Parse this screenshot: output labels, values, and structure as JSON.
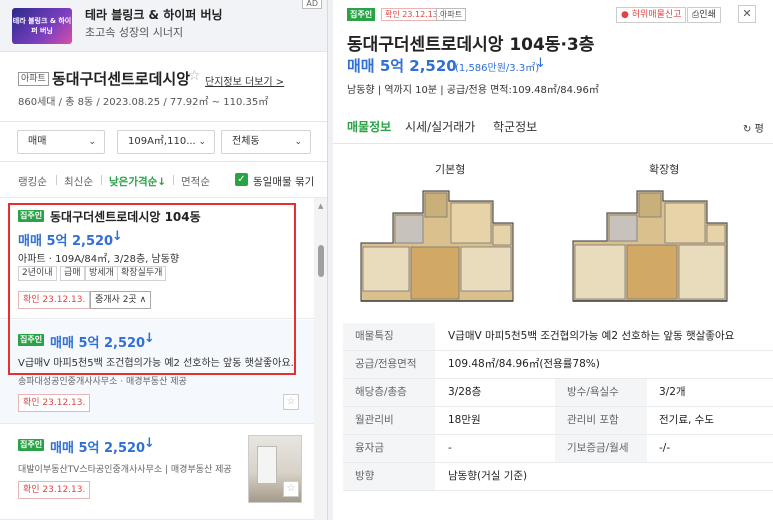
{
  "ad": {
    "thumb_text": "테라 블링크 & 하이퍼 버닝",
    "title": "테라 블링크 & 하이퍼 버닝",
    "subtitle": "초고속 성장의 시너지",
    "badge": "AD"
  },
  "complex": {
    "tag": "아파트",
    "name": "동대구더센트로데시앙",
    "star": "☆",
    "more_link": "단지정보 더보기 >",
    "info": "860세대 / 총 8동 / 2023.08.25 / 77.92㎡ ~ 110.35㎡"
  },
  "filters": {
    "trade_type": "매매",
    "area": "109A㎡,110...",
    "building": "전체동"
  },
  "sort": {
    "options": [
      "랭킹순",
      "최신순",
      "낮은가격순↓",
      "면적순"
    ],
    "active_index": 2,
    "same_listing_label": "동일매물 묶기",
    "same_listing_checked": true
  },
  "listings": [
    {
      "verify_tag": "집주인",
      "title": "동대구더센트로데시앙 104동",
      "price": "매매 5억 2,520",
      "arrow": "↓",
      "desc": "아파트 · 109A/84㎡, 3/28층, 남동향",
      "chips": [
        "2년이내",
        "급매",
        "방세개",
        "확장실두개"
      ],
      "confirm": "확인 23.12.13.",
      "agent_btn": "중개사 2곳 ∧"
    },
    {
      "verify_tag": "집주인",
      "price": "매매 5억 2,520",
      "arrow": "↓",
      "desc": "V급매V 마피5천5백 조건협의가능 예2 선호하는 앞동 햇살좋아요.",
      "source": "송파대성공인중개사사무소 · 매경부동산 제공",
      "confirm": "확인 23.12.13.",
      "fav": "☆"
    },
    {
      "verify_tag": "집주인",
      "price": "매매 5억 2,520",
      "arrow": "↓",
      "source": "대발이부동산TV스타공인중개사사무소 | 매경부동산 제공",
      "confirm": "확인 23.12.13.",
      "fav": "☆"
    }
  ],
  "detail": {
    "tag_owner": "집주인",
    "tag_confirm": "확인 23.12.13.",
    "tag_type": "아파트",
    "report_btn": "허위매물신고",
    "print_btn": "인쇄",
    "close": "✕",
    "title": "동대구더센트로데시앙 104동·3층",
    "price": "매매 5억 2,520",
    "per_area": "(1,586만원/3.3㎡)",
    "arrow": "↓",
    "meta": "남동향 | 역까지 10분 | 공급/전용 면적:109.48㎡/84.96㎡",
    "tabs": [
      "매물정보",
      "시세/실거래가",
      "학군정보"
    ],
    "tab_right": "평",
    "plans": [
      "기본형",
      "확장형"
    ],
    "rows": [
      {
        "k": "매물특징",
        "v": "V급매V 마피5천5백 조건협의가능 예2 선호하는 앞동 햇살좋아요"
      },
      {
        "k": "공급/전용면적",
        "v": "109.48㎡/84.96㎡(전용률78%)"
      },
      {
        "k": "해당층/총층",
        "v": "3/28층",
        "k2": "방수/욕실수",
        "v2": "3/2개"
      },
      {
        "k": "월관리비",
        "v": "18만원",
        "k2": "관리비 포함",
        "v2": "전기료, 수도"
      },
      {
        "k": "융자금",
        "v": "-",
        "k2": "기보증금/월세",
        "v2": "-/-"
      },
      {
        "k": "방향",
        "v": "남동향(거실 기준)"
      }
    ]
  }
}
